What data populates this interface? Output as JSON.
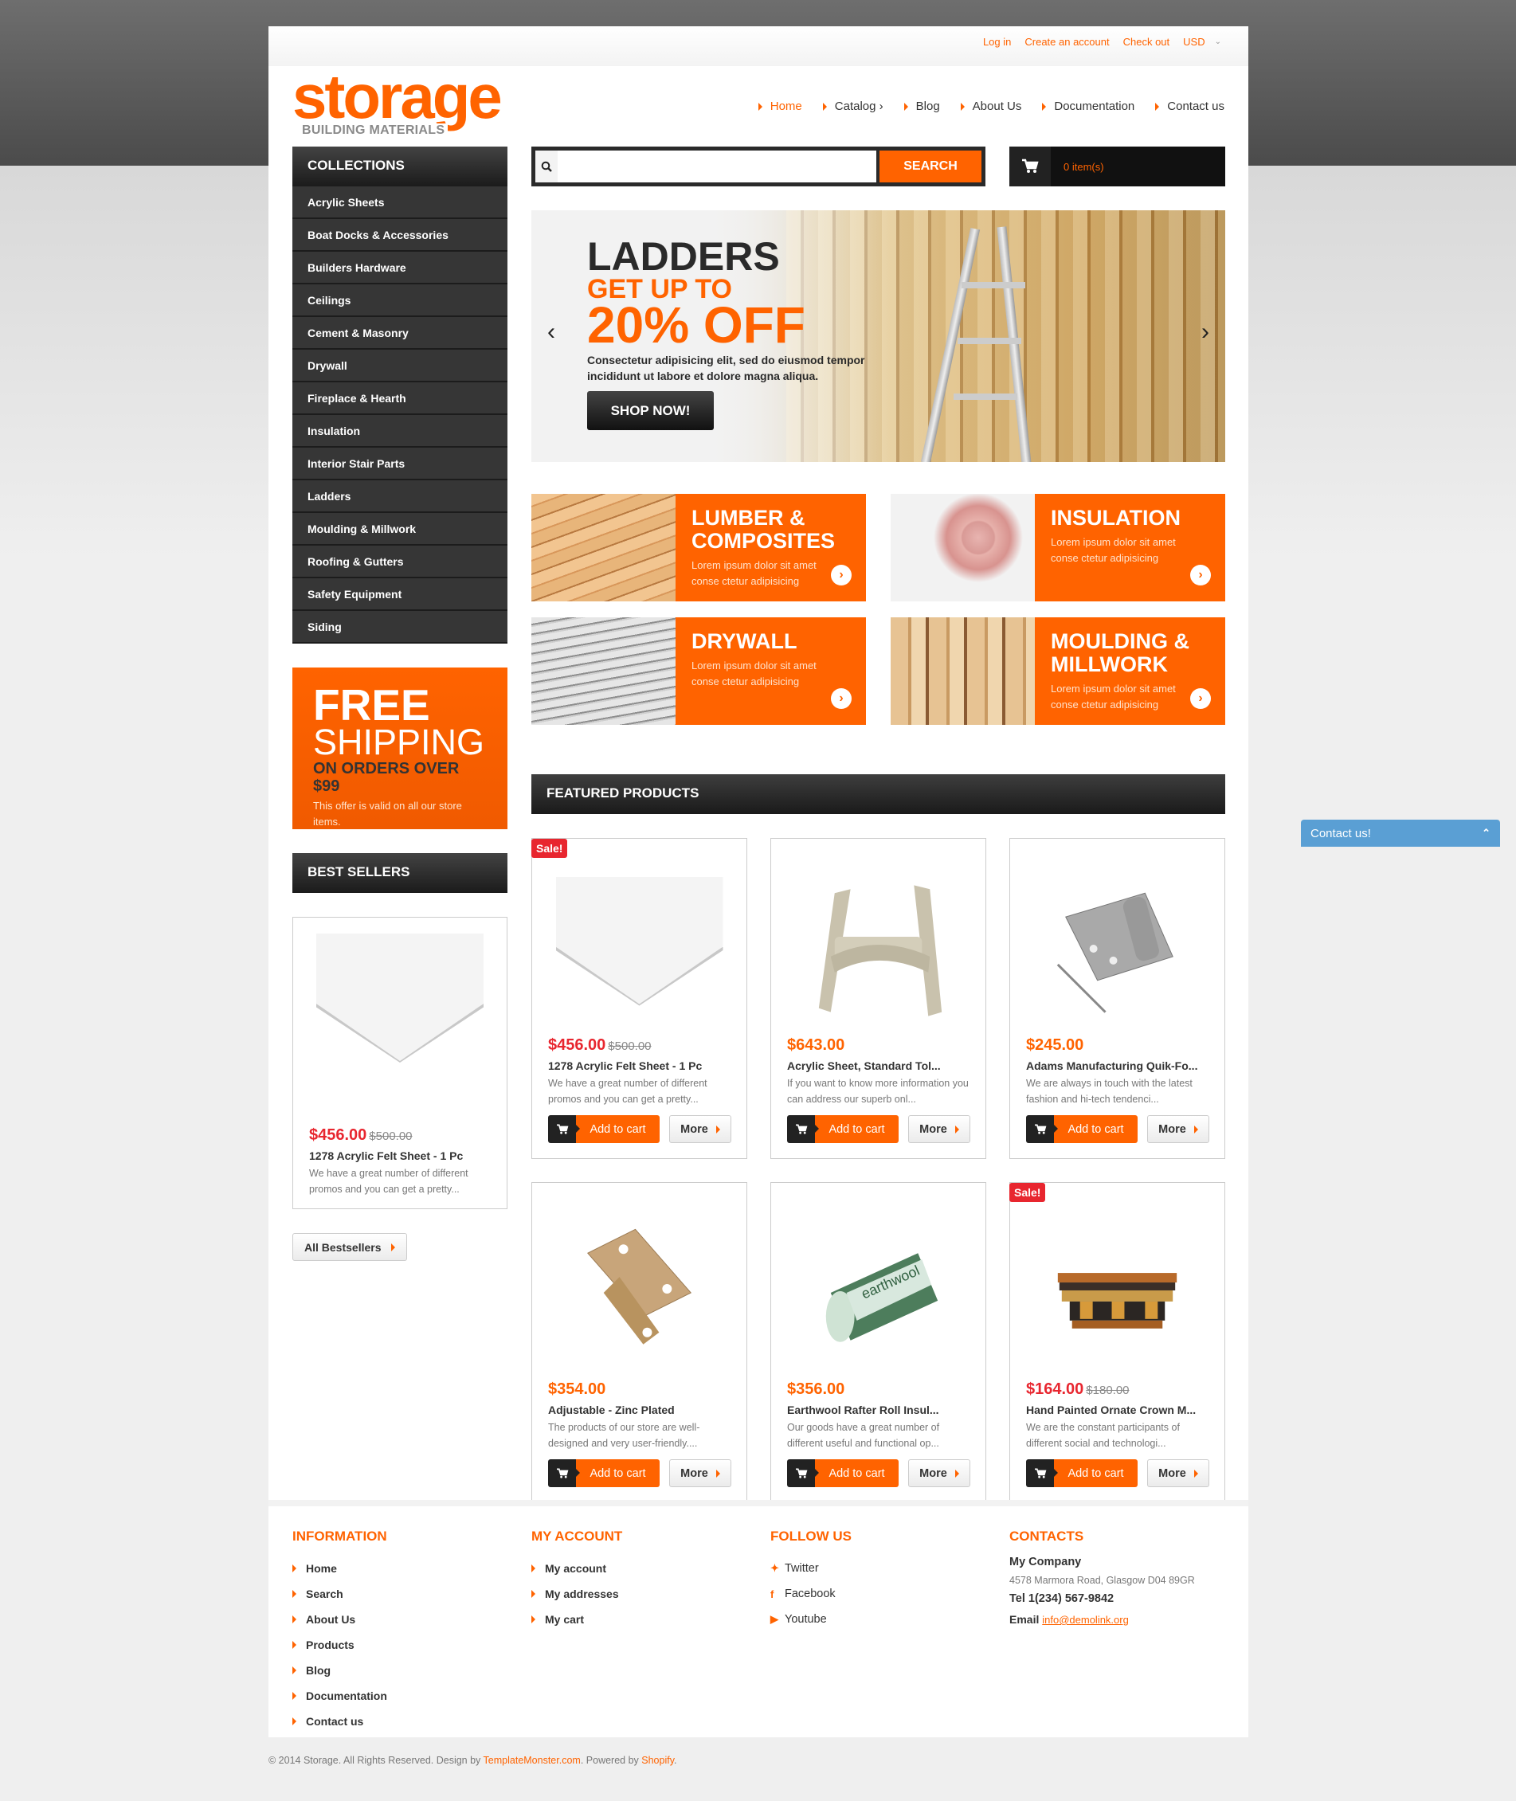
{
  "topbar": {
    "links": [
      "Log in",
      "Create an account",
      "Check out"
    ],
    "currency": "USD"
  },
  "logo": {
    "brand": "storage",
    "tagline": "BUILDING MATERIALS"
  },
  "nav": {
    "items": [
      "Home",
      "Catalog ›",
      "Blog",
      "About Us",
      "Documentation",
      "Contact us"
    ],
    "active": "Home"
  },
  "search": {
    "placeholder": "",
    "button": "SEARCH"
  },
  "cart": {
    "label": "0 item(s)"
  },
  "collections": {
    "title": "COLLECTIONS",
    "items": [
      "Acrylic Sheets",
      "Boat Docks & Accessories",
      "Builders Hardware",
      "Ceilings",
      "Cement & Masonry",
      "Drywall",
      "Fireplace & Hearth",
      "Insulation",
      "Interior Stair Parts",
      "Ladders",
      "Moulding & Millwork",
      "Roofing & Gutters",
      "Safety Equipment",
      "Siding"
    ]
  },
  "freeship": {
    "line1": "FREE",
    "line2": "SHIPPING",
    "line3": "ON ORDERS OVER $99",
    "note": "This offer is valid on all our store items."
  },
  "bestsellers": {
    "title": "BEST SELLERS",
    "product": {
      "price": "$456.00",
      "old_price": "$500.00",
      "name": "1278 Acrylic Felt Sheet - 1 Pc",
      "desc": "We have a great number of different promos and you can get a pretty..."
    },
    "all_button": "All Bestsellers"
  },
  "slider": {
    "title": "LADDERS",
    "subtitle": "GET UP TO",
    "offer": "20% OFF",
    "desc": "Consectetur adipisicing elit, sed do eiusmod tempor incididunt ut labore et dolore magna aliqua.",
    "button": "SHOP NOW!",
    "prev": "‹",
    "next": "›"
  },
  "banners": [
    {
      "title": "LUMBER & COMPOSITES",
      "desc": "Lorem ipsum dolor sit amet conse ctetur adipisicing"
    },
    {
      "title": "INSULATION",
      "desc": "Lorem ipsum dolor sit amet conse ctetur adipisicing"
    },
    {
      "title": "DRYWALL",
      "desc": "Lorem ipsum dolor sit amet conse ctetur adipisicing"
    },
    {
      "title": "MOULDING & MILLWORK",
      "desc": "Lorem ipsum dolor sit amet conse ctetur adipisicing"
    }
  ],
  "featured": {
    "title": "FEATURED PRODUCTS",
    "add_to_cart": "Add to cart",
    "more": "More",
    "sale_badge": "Sale!",
    "products": [
      {
        "price": "$456.00",
        "old_price": "$500.00",
        "sale": true,
        "name": "1278 Acrylic Felt Sheet - 1 Pc",
        "desc": "We have a great number of different promos and you can get a pretty..."
      },
      {
        "price": "$643.00",
        "old_price": "",
        "sale": false,
        "name": "Acrylic Sheet, Standard Tol...",
        "desc": "If you want to know more information you can address our superb onl..."
      },
      {
        "price": "$245.00",
        "old_price": "",
        "sale": false,
        "name": "Adams Manufacturing Quik-Fo...",
        "desc": "We are always in touch with the latest fashion and hi-tech tendenci..."
      },
      {
        "price": "$354.00",
        "old_price": "",
        "sale": false,
        "name": "Adjustable - Zinc Plated",
        "desc": "The products of our store are well-designed and very user-friendly...."
      },
      {
        "price": "$356.00",
        "old_price": "",
        "sale": false,
        "name": "Earthwool Rafter Roll Insul...",
        "desc": "Our goods have a great number of different useful and functional op..."
      },
      {
        "price": "$164.00",
        "old_price": "$180.00",
        "sale": true,
        "name": "Hand Painted Ornate Crown M...",
        "desc": "We are the constant participants of different social and technologi..."
      }
    ]
  },
  "footer": {
    "information": {
      "title": "INFORMATION",
      "items": [
        "Home",
        "Search",
        "About Us",
        "Products",
        "Blog",
        "Documentation",
        "Contact us"
      ]
    },
    "account": {
      "title": "MY ACCOUNT",
      "items": [
        "My account",
        "My addresses",
        "My cart"
      ]
    },
    "follow": {
      "title": "FOLLOW US",
      "items": [
        {
          "icon": "twitter-icon",
          "label": "Twitter"
        },
        {
          "icon": "facebook-icon",
          "label": "Facebook"
        },
        {
          "icon": "youtube-icon",
          "label": "Youtube"
        }
      ]
    },
    "contacts": {
      "title": "CONTACTS",
      "company": "My Company",
      "address": "4578 Marmora Road, Glasgow D04 89GR",
      "tel": "Tel 1(234) 567-9842",
      "email_label": "Email",
      "email": "info@demolink.org"
    }
  },
  "copyright": {
    "text1": "© 2014 Storage. All Rights Reserved. Design by ",
    "link1": "TemplateMonster.com",
    "text2": ". Powered by ",
    "link2": "Shopify",
    "text3": "."
  },
  "contact_widget": {
    "label": "Contact us!"
  },
  "colors": {
    "accent": "#ff6300",
    "sale": "#e8262f",
    "dark": "#363636",
    "widget": "#5a9fd4"
  }
}
